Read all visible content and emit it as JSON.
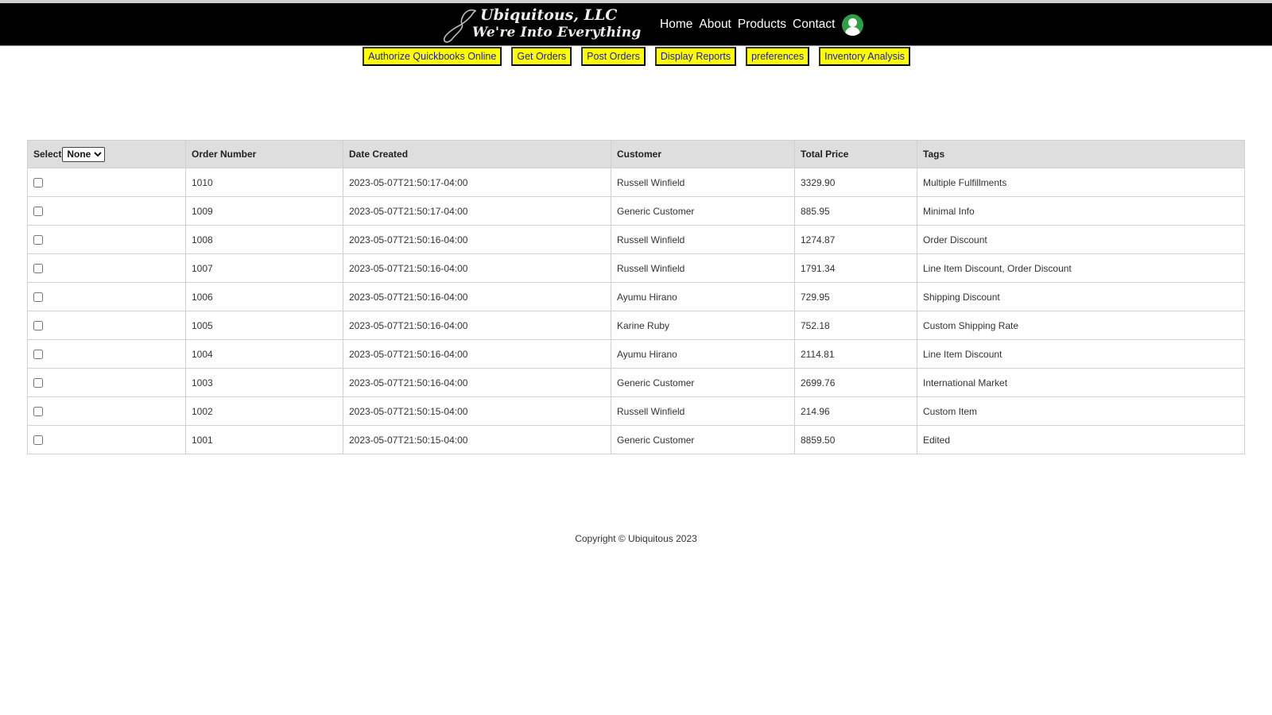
{
  "header": {
    "brand_title": "Ubiquitous, LLC",
    "brand_tagline": "We're Into Everything",
    "nav": [
      {
        "label": "Home"
      },
      {
        "label": "About"
      },
      {
        "label": "Products"
      },
      {
        "label": "Contact"
      }
    ],
    "user_icon": "user-avatar-icon"
  },
  "toolbar": {
    "buttons": [
      {
        "label": "Authorize Quickbooks Online"
      },
      {
        "label": "Get Orders"
      },
      {
        "label": "Post Orders"
      },
      {
        "label": "Display Reports"
      },
      {
        "label": "preferences"
      },
      {
        "label": "Inventory Analysis"
      }
    ],
    "button_color": "#ffff00",
    "button_text_color": "#1a1a9c"
  },
  "orders_table": {
    "select_label": "Select",
    "select_value": "None",
    "columns": [
      "Order Number",
      "Date Created",
      "Customer",
      "Total Price",
      "Tags"
    ],
    "rows": [
      {
        "order": "1010",
        "date": "2023-05-07T21:50:17-04:00",
        "customer": "Russell Winfield",
        "total": "3329.90",
        "tags": "Multiple Fulfillments",
        "checked": false
      },
      {
        "order": "1009",
        "date": "2023-05-07T21:50:17-04:00",
        "customer": "Generic Customer",
        "total": "885.95",
        "tags": "Minimal Info",
        "checked": false
      },
      {
        "order": "1008",
        "date": "2023-05-07T21:50:16-04:00",
        "customer": "Russell Winfield",
        "total": "1274.87",
        "tags": "Order Discount",
        "checked": false
      },
      {
        "order": "1007",
        "date": "2023-05-07T21:50:16-04:00",
        "customer": "Russell Winfield",
        "total": "1791.34",
        "tags": "Line Item Discount, Order Discount",
        "checked": false
      },
      {
        "order": "1006",
        "date": "2023-05-07T21:50:16-04:00",
        "customer": "Ayumu Hirano",
        "total": "729.95",
        "tags": "Shipping Discount",
        "checked": false
      },
      {
        "order": "1005",
        "date": "2023-05-07T21:50:16-04:00",
        "customer": "Karine Ruby",
        "total": "752.18",
        "tags": "Custom Shipping Rate",
        "checked": false
      },
      {
        "order": "1004",
        "date": "2023-05-07T21:50:16-04:00",
        "customer": "Ayumu Hirano",
        "total": "2114.81",
        "tags": "Line Item Discount",
        "checked": false
      },
      {
        "order": "1003",
        "date": "2023-05-07T21:50:16-04:00",
        "customer": "Generic Customer",
        "total": "2699.76",
        "tags": "International Market",
        "checked": false
      },
      {
        "order": "1002",
        "date": "2023-05-07T21:50:15-04:00",
        "customer": "Russell Winfield",
        "total": "214.96",
        "tags": "Custom Item",
        "checked": false
      },
      {
        "order": "1001",
        "date": "2023-05-07T21:50:15-04:00",
        "customer": "Generic Customer",
        "total": "8859.50",
        "tags": "Edited",
        "checked": false
      }
    ]
  },
  "footer": {
    "copyright": "Copyright © Ubiquitous 2023"
  }
}
